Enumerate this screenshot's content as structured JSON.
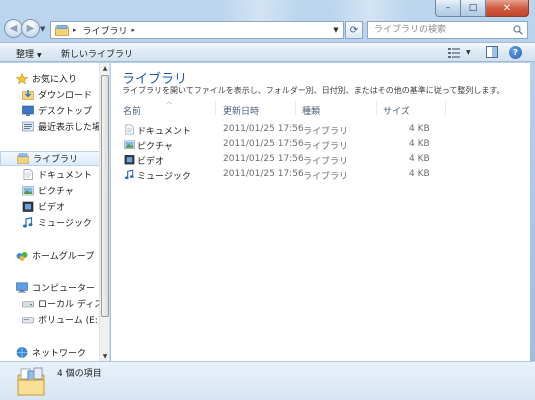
{
  "window": {
    "caption": {
      "minimize_glyph": "–",
      "maximize_glyph": "□",
      "close_glyph": "✕"
    }
  },
  "nav": {
    "back_glyph": "◀",
    "forward_glyph": "▶",
    "address": {
      "crumb": "ライブラリ",
      "separator": "▸"
    },
    "refresh_glyph": "⟳",
    "search_placeholder": "ライブラリの検索"
  },
  "toolbar": {
    "organize_label": "整理",
    "organize_arrow": "▼",
    "new_library_label": "新しいライブラリ",
    "help_label": "?"
  },
  "sidebar": {
    "items": [
      {
        "label": "お気に入り",
        "icon": "star-icon"
      },
      {
        "label": "ダウンロード",
        "icon": "download-folder-icon"
      },
      {
        "label": "デスクトップ",
        "icon": "desktop-icon"
      },
      {
        "label": "最近表示した場所",
        "icon": "recent-places-icon"
      },
      {
        "label": "ライブラリ",
        "icon": "library-icon",
        "selected": true
      },
      {
        "label": "ドキュメント",
        "icon": "documents-icon"
      },
      {
        "label": "ピクチャ",
        "icon": "pictures-icon"
      },
      {
        "label": "ビデオ",
        "icon": "videos-icon"
      },
      {
        "label": "ミュージック",
        "icon": "music-icon"
      },
      {
        "label": "ホームグループ",
        "icon": "homegroup-icon"
      },
      {
        "label": "コンピューター",
        "icon": "computer-icon"
      },
      {
        "label": "ローカル ディスク",
        "icon": "local-disk-icon"
      },
      {
        "label": "ボリューム (E:)",
        "icon": "drive-icon"
      },
      {
        "label": "ネットワーク",
        "icon": "network-icon"
      }
    ]
  },
  "main": {
    "title": "ライブラリ",
    "description": "ライブラリを開いてファイルを表示し、フォルダー別、日付別、またはその他の基準に従って整列します。",
    "columns": [
      "名前",
      "更新日時",
      "種類",
      "サイズ"
    ],
    "rows": [
      {
        "name": "ドキュメント",
        "modified": "2011/01/25 17:56",
        "type": "ライブラリ",
        "size": "4 KB",
        "icon": "documents-icon"
      },
      {
        "name": "ピクチャ",
        "modified": "2011/01/25 17:56",
        "type": "ライブラリ",
        "size": "4 KB",
        "icon": "pictures-icon"
      },
      {
        "name": "ビデオ",
        "modified": "2011/01/25 17:56",
        "type": "ライブラリ",
        "size": "4 KB",
        "icon": "videos-icon"
      },
      {
        "name": "ミュージック",
        "modified": "2011/01/25 17:56",
        "type": "ライブラリ",
        "size": "4 KB",
        "icon": "music-icon"
      }
    ]
  },
  "status": {
    "item_count": "4 個の項目"
  },
  "colors": {
    "title_blue": "#1e5aa8",
    "selection": "#dcebfc",
    "frame": "#bcd6ee"
  }
}
